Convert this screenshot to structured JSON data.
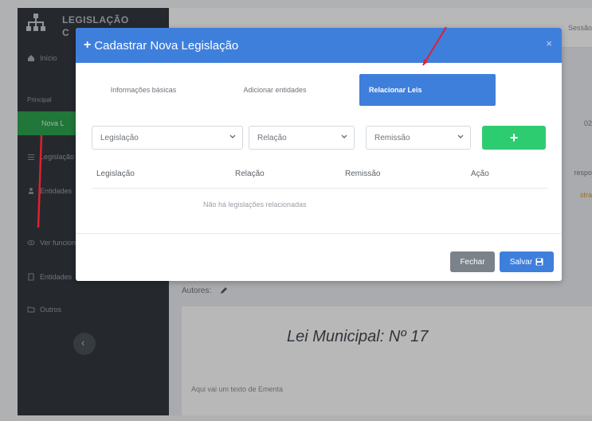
{
  "brand": {
    "line1": "LEGISLAÇÃO",
    "line2": "C"
  },
  "sidebar": {
    "items": [
      {
        "label": "Início"
      },
      {
        "label": "Principal"
      },
      {
        "label": "Nova L"
      },
      {
        "label": "Legislação"
      },
      {
        "label": "Entidades"
      },
      {
        "label": "Ver funcion."
      },
      {
        "label": "Entidades"
      },
      {
        "label": "Outros"
      }
    ]
  },
  "topbar": {
    "right_text": "Sessão"
  },
  "modal": {
    "title_icon": "+",
    "title": "Cadastrar Nova Legislação",
    "close_label": "×",
    "tabs": [
      {
        "label": "Informações básicas"
      },
      {
        "label": "Adicionar entidades"
      },
      {
        "label": "Relacionar Leis"
      }
    ],
    "selects": [
      {
        "value": "Legislação"
      },
      {
        "value": "Relação"
      },
      {
        "value": "Remissão"
      }
    ],
    "add_label": "+",
    "table": {
      "headers": [
        "Legislação",
        "Relação",
        "Remissão",
        "Ação"
      ],
      "empty_message": "Não há legislações relacionadas"
    },
    "footer": {
      "close_label": "Fechar",
      "save_label": "Salvar"
    }
  },
  "background": {
    "autor_label": "Autores:",
    "law_title": "Lei Municipal: Nº 17",
    "law_text": "Aqui vai um texto de Ementa",
    "right_edge_1": "02",
    "right_edge_2": "respo",
    "right_edge_3": "stra"
  },
  "colors": {
    "primary": "#3f7fdc",
    "success": "#2ecc71",
    "sidebar_active": "#2ea44f",
    "sidebar_bg": "#343a40",
    "annotation_arrow": "#e0202e"
  },
  "icons": [
    "sitemap-icon",
    "home-icon",
    "plus-icon",
    "close-icon",
    "chevron-down-icon",
    "floppy-disk-icon",
    "pencil-icon"
  ]
}
